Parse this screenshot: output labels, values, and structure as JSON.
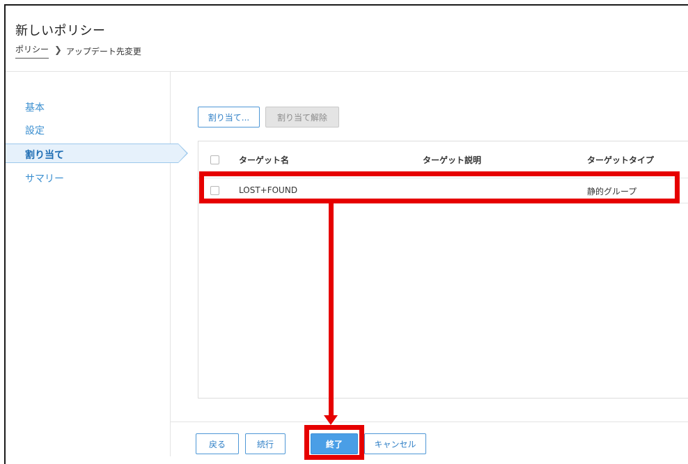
{
  "header": {
    "title": "新しいポリシー",
    "breadcrumb": {
      "root": "ポリシー",
      "separator_icon": "chevron-right-icon",
      "current": "アップデート先変更"
    }
  },
  "sidebar": {
    "items": [
      {
        "label": "基本",
        "active": false
      },
      {
        "label": "設定",
        "active": false
      },
      {
        "label": "割り当て",
        "active": true
      },
      {
        "label": "サマリー",
        "active": false
      }
    ]
  },
  "toolbar": {
    "assign_label": "割り当て...",
    "unassign_label": "割り当て解除",
    "unassign_disabled": true
  },
  "table": {
    "columns": [
      "ターゲット名",
      "ターゲット説明",
      "ターゲットタイプ"
    ],
    "rows": [
      {
        "name": "LOST+FOUND",
        "description": "",
        "type": "静的グループ",
        "checked": false
      }
    ]
  },
  "footer": {
    "back_label": "戻る",
    "continue_label": "続行",
    "finish_label": "終了",
    "cancel_label": "キャンセル"
  },
  "annotation": {
    "color": "#e60000"
  },
  "colors": {
    "accent": "#3b8fd0",
    "primary_button": "#4a9ee6",
    "active_nav_bg": "#e6f1fb"
  }
}
